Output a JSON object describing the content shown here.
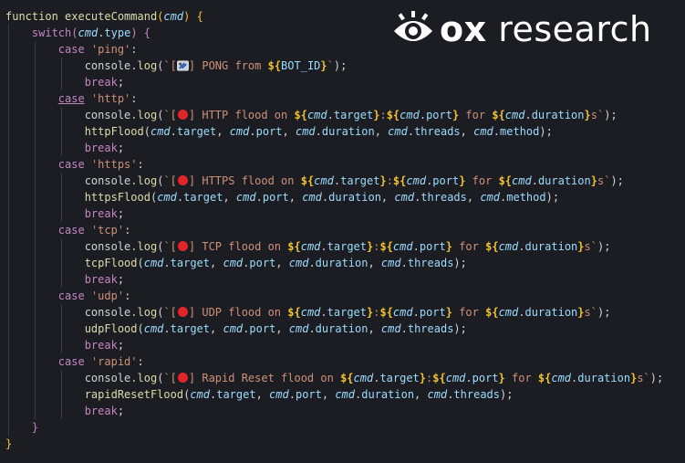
{
  "logo": {
    "brand": "ox",
    "suffix": " research"
  },
  "code": {
    "fn_kw": "function",
    "fn_name": "executeCommand",
    "param": "cmd",
    "switch_kw": "switch",
    "type_prop": "type",
    "cases": [
      {
        "label": "'ping'",
        "emoji": "satellite",
        "log_text": " PONG from ",
        "bot_var": "BOT_ID",
        "call": null
      },
      {
        "label": "'http'",
        "emoji": "red-circle",
        "log_text": " HTTP flood on ",
        "call": "httpFlood",
        "method": true,
        "underline": true
      },
      {
        "label": "'https'",
        "emoji": "red-circle",
        "log_text": " HTTPS flood on ",
        "call": "httpsFlood",
        "method": true
      },
      {
        "label": "'tcp'",
        "emoji": "red-circle",
        "log_text": " TCP flood on ",
        "call": "tcpFlood",
        "method": false
      },
      {
        "label": "'udp'",
        "emoji": "red-circle",
        "log_text": " UDP flood on ",
        "call": "udpFlood",
        "method": false
      },
      {
        "label": "'rapid'",
        "emoji": "red-circle",
        "log_text": " Rapid Reset flood on ",
        "call": "rapidResetFlood",
        "method": false
      }
    ],
    "case_kw": "case",
    "break_kw": "break",
    "console": "console",
    "log": "log",
    "target": "target",
    "port": "port",
    "duration": "duration",
    "threads": "threads",
    "method": "method",
    "seconds_suffix": "s"
  },
  "colors": {
    "background": "#1b1d23",
    "keyword": "#c586c0",
    "function": "#dcdcaa",
    "string": "#ce9178",
    "interpolation": "#f1c232"
  }
}
